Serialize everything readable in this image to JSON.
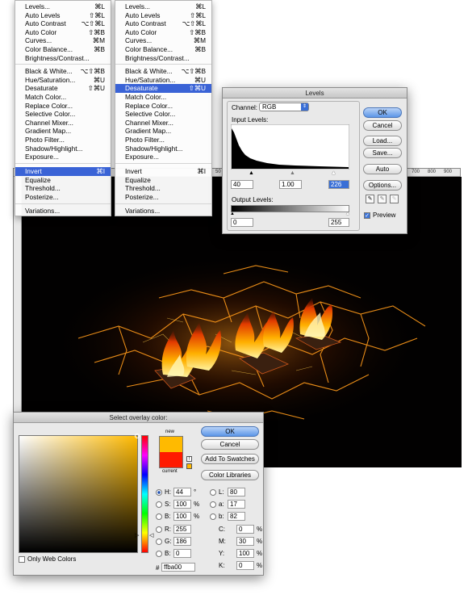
{
  "menus": {
    "left_items": [
      {
        "label": "Levels...",
        "shortcut": "⌘L"
      },
      {
        "label": "Auto Levels",
        "shortcut": "⇧⌘L"
      },
      {
        "label": "Auto Contrast",
        "shortcut": "⌥⇧⌘L"
      },
      {
        "label": "Auto Color",
        "shortcut": "⇧⌘B"
      },
      {
        "label": "Curves...",
        "shortcut": "⌘M"
      },
      {
        "label": "Color Balance...",
        "shortcut": "⌘B"
      },
      {
        "label": "Brightness/Contrast...",
        "shortcut": ""
      },
      {
        "label": "Black & White...",
        "shortcut": "⌥⇧⌘B"
      },
      {
        "label": "Hue/Saturation...",
        "shortcut": "⌘U"
      },
      {
        "label": "Desaturate",
        "shortcut": "⇧⌘U"
      },
      {
        "label": "Match Color...",
        "shortcut": ""
      },
      {
        "label": "Replace Color...",
        "shortcut": ""
      },
      {
        "label": "Selective Color...",
        "shortcut": ""
      },
      {
        "label": "Channel Mixer...",
        "shortcut": ""
      },
      {
        "label": "Gradient Map...",
        "shortcut": ""
      },
      {
        "label": "Photo Filter...",
        "shortcut": ""
      },
      {
        "label": "Shadow/Highlight...",
        "shortcut": ""
      },
      {
        "label": "Exposure...",
        "shortcut": ""
      },
      {
        "label": "Invert",
        "shortcut": "⌘I"
      },
      {
        "label": "Equalize",
        "shortcut": ""
      },
      {
        "label": "Threshold...",
        "shortcut": ""
      },
      {
        "label": "Posterize...",
        "shortcut": ""
      },
      {
        "label": "Variations...",
        "shortcut": ""
      }
    ],
    "right_items": [
      {
        "label": "Levels...",
        "shortcut": "⌘L"
      },
      {
        "label": "Auto Levels",
        "shortcut": "⇧⌘L"
      },
      {
        "label": "Auto Contrast",
        "shortcut": "⌥⇧⌘L"
      },
      {
        "label": "Auto Color",
        "shortcut": "⇧⌘B"
      },
      {
        "label": "Curves...",
        "shortcut": "⌘M"
      },
      {
        "label": "Color Balance...",
        "shortcut": "⌘B"
      },
      {
        "label": "Brightness/Contrast...",
        "shortcut": ""
      },
      {
        "label": "Black & White...",
        "shortcut": "⌥⇧⌘B"
      },
      {
        "label": "Hue/Saturation...",
        "shortcut": "⌘U"
      },
      {
        "label": "Desaturate",
        "shortcut": "⇧⌘U"
      },
      {
        "label": "Match Color...",
        "shortcut": ""
      },
      {
        "label": "Replace Color...",
        "shortcut": ""
      },
      {
        "label": "Selective Color...",
        "shortcut": ""
      },
      {
        "label": "Channel Mixer...",
        "shortcut": ""
      },
      {
        "label": "Gradient Map...",
        "shortcut": ""
      },
      {
        "label": "Photo Filter...",
        "shortcut": ""
      },
      {
        "label": "Shadow/Highlight...",
        "shortcut": ""
      },
      {
        "label": "Exposure...",
        "shortcut": ""
      },
      {
        "label": "Invert",
        "shortcut": "⌘I"
      },
      {
        "label": "Equalize",
        "shortcut": ""
      },
      {
        "label": "Threshold...",
        "shortcut": ""
      },
      {
        "label": "Posterize...",
        "shortcut": ""
      },
      {
        "label": "Variations...",
        "shortcut": ""
      }
    ],
    "left_selected": "Invert",
    "right_selected": "Desaturate"
  },
  "canvas": {
    "ruler_labels": [
      "50",
      "700",
      "800",
      "900"
    ]
  },
  "levels": {
    "title": "Levels",
    "channel_label": "Channel:",
    "channel_value": "RGB",
    "input_label": "Input Levels:",
    "input_black": "40",
    "input_gamma": "1.00",
    "input_white": "226",
    "output_label": "Output Levels:",
    "output_black": "0",
    "output_white": "255",
    "ok": "OK",
    "cancel": "Cancel",
    "load": "Load...",
    "save": "Save...",
    "auto": "Auto",
    "options": "Options...",
    "preview": "Preview"
  },
  "color_picker": {
    "title": "Select overlay color:",
    "ok": "OK",
    "cancel": "Cancel",
    "add_swatches": "Add To Swatches",
    "color_libraries": "Color Libraries",
    "new_label": "new",
    "current_label": "current",
    "new_color": "#ffba00",
    "current_color": "#ff1a00",
    "only_web": "Only Web Colors",
    "hsb": [
      {
        "k": "H:",
        "v": "44",
        "u": "°"
      },
      {
        "k": "S:",
        "v": "100",
        "u": "%"
      },
      {
        "k": "B:",
        "v": "100",
        "u": "%"
      }
    ],
    "rgb": [
      {
        "k": "R:",
        "v": "255"
      },
      {
        "k": "G:",
        "v": "186"
      },
      {
        "k": "B:",
        "v": "0"
      }
    ],
    "lab": [
      {
        "k": "L:",
        "v": "80"
      },
      {
        "k": "a:",
        "v": "17"
      },
      {
        "k": "b:",
        "v": "82"
      }
    ],
    "cmyk": [
      {
        "k": "C:",
        "v": "0",
        "u": "%"
      },
      {
        "k": "M:",
        "v": "30",
        "u": "%"
      },
      {
        "k": "Y:",
        "v": "100",
        "u": "%"
      },
      {
        "k": "K:",
        "v": "0",
        "u": "%"
      }
    ],
    "hex_label": "#",
    "hex": "ffba00"
  }
}
